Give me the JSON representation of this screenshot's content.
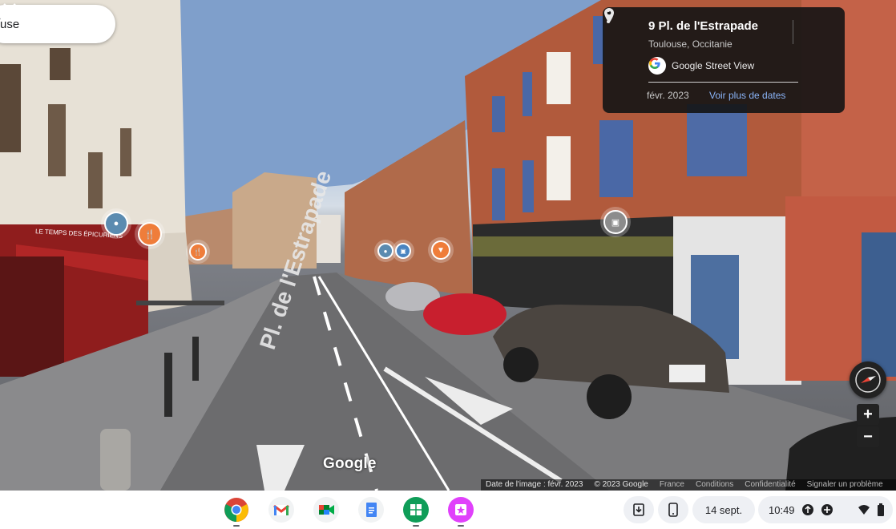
{
  "search": {
    "value": "use"
  },
  "info_card": {
    "title": "9 Pl. de l'Estrapade",
    "subtitle": "Toulouse, Occitanie",
    "source": "Google Street View",
    "date": "févr. 2023",
    "more_dates_link": "Voir plus de dates"
  },
  "street_sign": "Pl. de l'Estrapade",
  "storefront_sign": "LE TEMPS DES ÉPICURIENS",
  "watermark": "Google",
  "footer": {
    "image_date": "Date de l'image : févr. 2023",
    "copyright": "© 2023 Google",
    "country": "France",
    "terms": "Conditions",
    "privacy": "Confidentialité",
    "report": "Signaler un problème"
  },
  "zoom": {
    "in": "+",
    "out": "−"
  },
  "shelf": {
    "apps": [
      "chrome-icon",
      "gmail-icon",
      "meet-icon",
      "docs-icon",
      "sheets-icon",
      "jamboard-icon"
    ],
    "date": "14 sept.",
    "time": "10:49"
  },
  "colors": {
    "poi_blue": "#5b8bb0",
    "poi_orange": "#ef7d3a",
    "card_bg": "#141414",
    "link": "#8ab4f8"
  }
}
